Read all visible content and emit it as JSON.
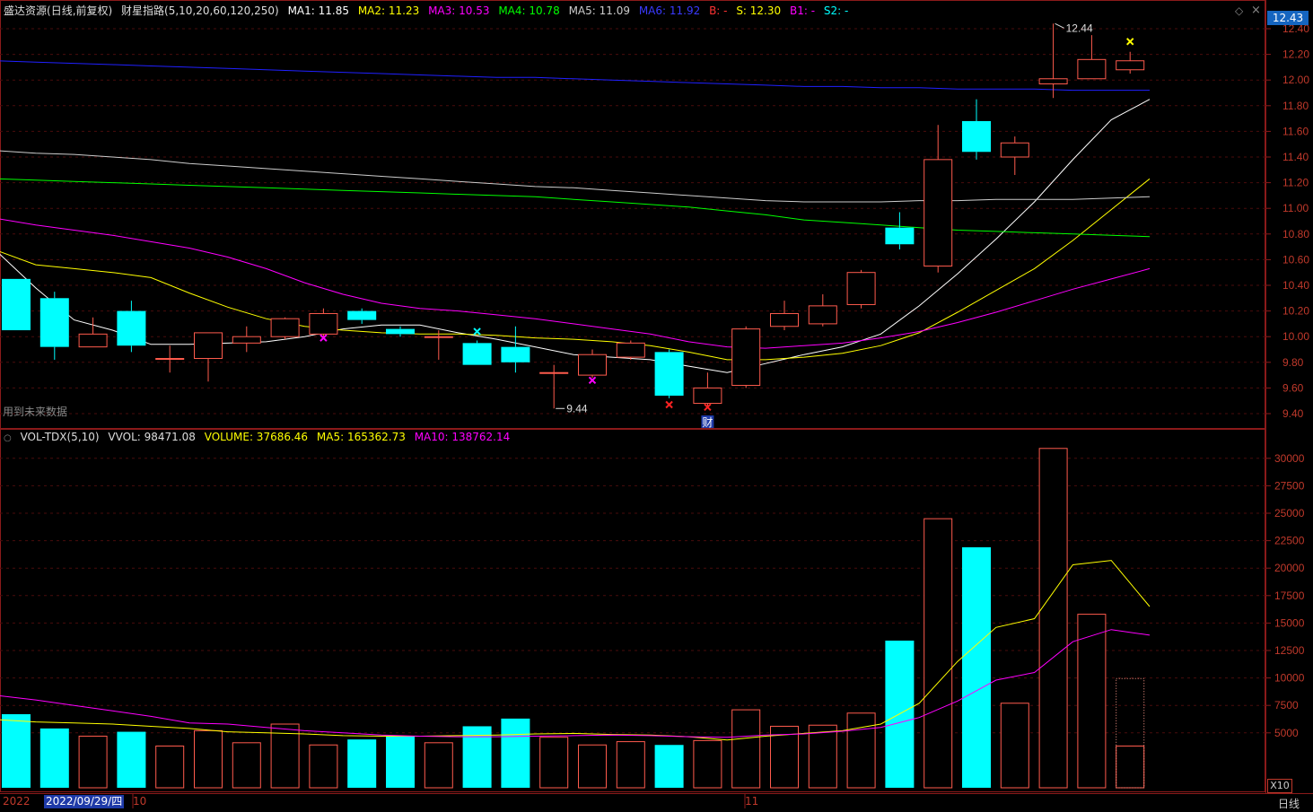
{
  "header": {
    "stock_name": "盛达资源",
    "period_mode": "(日线,前复权)",
    "indicator_name": "财星指路(5,10,20,60,120,250)",
    "ma1": "MA1: 11.85",
    "ma2": "MA2: 11.23",
    "ma3": "MA3: 10.53",
    "ma4": "MA4: 10.78",
    "ma5": "MA5: 11.09",
    "ma6": "MA6: 11.92",
    "b": "B: -",
    "s": "S: 12.30",
    "b1": "B1: -",
    "s2": "S2: -"
  },
  "vol_header": {
    "name": "VOL-TDX(5,10)",
    "vvol": "VVOL: 98471.08",
    "volume": "VOLUME: 37686.46",
    "ma5": "MA5: 165362.73",
    "ma10": "MA10: 138762.14"
  },
  "current_price_tag": "12.43",
  "future_data_note": "用到未来数据",
  "cai_marker": "财",
  "scale_label": "X10",
  "period_label": "日线",
  "date_labels": [
    "2022",
    "2022/09/29/四",
    "10",
    "11"
  ],
  "colors": {
    "up": "#ff5b4d",
    "down": "#00ffff",
    "ma1": "#ffffff",
    "ma2": "#ffff00",
    "ma3": "#ff00ff",
    "ma4": "#00ff00",
    "ma5": "#cccccc",
    "ma6": "#2020ff"
  },
  "chart_data": [
    {
      "type": "candlestick",
      "title": "",
      "ylim": [
        9.3,
        12.5
      ],
      "y_ticks": [
        9.4,
        9.6,
        9.8,
        10.0,
        10.2,
        10.4,
        10.6,
        10.8,
        11.0,
        11.2,
        11.4,
        11.6,
        11.8,
        12.0,
        12.2,
        12.4
      ],
      "annotations": [
        {
          "text": "12.44",
          "type": "high"
        },
        {
          "text": "9.44",
          "type": "low"
        }
      ],
      "candles": [
        {
          "open": 10.45,
          "close": 10.05,
          "high": 10.45,
          "low": 10.05
        },
        {
          "open": 10.3,
          "close": 9.92,
          "high": 10.35,
          "low": 9.82
        },
        {
          "open": 9.92,
          "close": 10.02,
          "high": 10.15,
          "low": 9.92
        },
        {
          "open": 10.2,
          "close": 9.93,
          "high": 10.28,
          "low": 9.88
        },
        {
          "open": 9.83,
          "close": 9.83,
          "high": 9.93,
          "low": 9.72
        },
        {
          "open": 9.83,
          "close": 10.03,
          "high": 10.03,
          "low": 9.65
        },
        {
          "open": 9.95,
          "close": 10.0,
          "high": 10.08,
          "low": 9.88
        },
        {
          "open": 10.0,
          "close": 10.14,
          "high": 10.15,
          "low": 9.98
        },
        {
          "open": 10.02,
          "close": 10.18,
          "high": 10.22,
          "low": 10.0
        },
        {
          "open": 10.2,
          "close": 10.13,
          "high": 10.22,
          "low": 10.1
        },
        {
          "open": 10.06,
          "close": 10.02,
          "high": 10.08,
          "low": 10.0
        },
        {
          "open": 10.0,
          "close": 10.0,
          "high": 10.05,
          "low": 9.82
        },
        {
          "open": 9.95,
          "close": 9.78,
          "high": 9.97,
          "low": 9.78
        },
        {
          "open": 9.92,
          "close": 9.8,
          "high": 10.08,
          "low": 9.72
        },
        {
          "open": 9.72,
          "close": 9.72,
          "high": 9.78,
          "low": 9.44
        },
        {
          "open": 9.7,
          "close": 9.86,
          "high": 9.9,
          "low": 9.68
        },
        {
          "open": 9.84,
          "close": 9.95,
          "high": 9.97,
          "low": 9.82
        },
        {
          "open": 9.88,
          "close": 9.54,
          "high": 9.9,
          "low": 9.52
        },
        {
          "open": 9.48,
          "close": 9.6,
          "high": 9.72,
          "low": 9.46
        },
        {
          "open": 9.62,
          "close": 10.06,
          "high": 10.08,
          "low": 9.6
        },
        {
          "open": 10.08,
          "close": 10.18,
          "high": 10.28,
          "low": 10.05
        },
        {
          "open": 10.1,
          "close": 10.24,
          "high": 10.33,
          "low": 10.08
        },
        {
          "open": 10.25,
          "close": 10.5,
          "high": 10.52,
          "low": 10.22
        },
        {
          "open": 10.85,
          "close": 10.72,
          "high": 10.97,
          "low": 10.68
        },
        {
          "open": 10.55,
          "close": 11.38,
          "high": 11.65,
          "low": 10.5
        },
        {
          "open": 11.68,
          "close": 11.44,
          "high": 11.85,
          "low": 11.38
        },
        {
          "open": 11.4,
          "close": 11.51,
          "high": 11.56,
          "low": 11.26
        },
        {
          "open": 11.97,
          "close": 12.01,
          "high": 12.44,
          "low": 11.86
        },
        {
          "open": 12.01,
          "close": 12.16,
          "high": 12.35,
          "low": 12.01
        },
        {
          "open": 12.08,
          "close": 12.15,
          "high": 12.22,
          "low": 12.05
        }
      ],
      "series": [
        {
          "name": "MA1",
          "values": [
            10.66,
            10.38,
            10.13,
            10.05,
            9.94,
            9.94,
            9.95,
            9.96,
            10.0,
            10.06,
            10.09,
            10.09,
            10.03,
            9.98,
            9.92,
            9.86,
            9.84,
            9.82,
            9.77,
            9.72,
            9.79,
            9.86,
            9.92,
            10.02,
            10.24,
            10.49,
            10.76,
            11.05,
            11.38,
            11.69,
            11.85
          ]
        },
        {
          "name": "MA2",
          "values": [
            10.67,
            10.56,
            10.53,
            10.5,
            10.46,
            10.34,
            10.23,
            10.14,
            10.08,
            10.05,
            10.03,
            10.02,
            10.02,
            10.01,
            9.99,
            9.98,
            9.96,
            9.93,
            9.88,
            9.82,
            9.82,
            9.84,
            9.87,
            9.93,
            10.03,
            10.19,
            10.36,
            10.53,
            10.75,
            10.99,
            11.23
          ]
        },
        {
          "name": "MA3",
          "values": [
            10.92,
            10.87,
            10.83,
            10.79,
            10.74,
            10.69,
            10.62,
            10.53,
            10.42,
            10.33,
            10.26,
            10.22,
            10.2,
            10.17,
            10.14,
            10.1,
            10.06,
            10.02,
            9.96,
            9.92,
            9.91,
            9.93,
            9.95,
            9.99,
            10.04,
            10.11,
            10.19,
            10.28,
            10.37,
            10.45,
            10.53
          ]
        },
        {
          "name": "MA4",
          "values": [
            11.23,
            11.22,
            11.21,
            11.2,
            11.19,
            11.18,
            11.17,
            11.16,
            11.15,
            11.14,
            11.13,
            11.12,
            11.11,
            11.1,
            11.09,
            11.07,
            11.05,
            11.03,
            11.01,
            10.98,
            10.95,
            10.91,
            10.89,
            10.87,
            10.85,
            10.83,
            10.82,
            10.81,
            10.8,
            10.79,
            10.78
          ]
        },
        {
          "name": "MA5",
          "values": [
            11.45,
            11.43,
            11.42,
            11.4,
            11.38,
            11.35,
            11.33,
            11.31,
            11.29,
            11.27,
            11.25,
            11.23,
            11.21,
            11.19,
            11.17,
            11.16,
            11.14,
            11.12,
            11.1,
            11.08,
            11.06,
            11.05,
            11.05,
            11.05,
            11.06,
            11.06,
            11.07,
            11.07,
            11.07,
            11.08,
            11.09
          ]
        },
        {
          "name": "MA6",
          "values": [
            12.15,
            12.14,
            12.13,
            12.12,
            12.11,
            12.1,
            12.09,
            12.08,
            12.07,
            12.06,
            12.05,
            12.04,
            12.03,
            12.02,
            12.02,
            12.01,
            12.0,
            11.99,
            11.98,
            11.97,
            11.96,
            11.95,
            11.95,
            11.94,
            11.94,
            11.93,
            11.93,
            11.93,
            11.92,
            11.92,
            11.92
          ]
        }
      ],
      "signals": [
        {
          "index": 8,
          "type": "x",
          "color": "#ff00ff",
          "value": 9.99
        },
        {
          "index": 12,
          "type": "x",
          "color": "#00ffff",
          "value": 10.04
        },
        {
          "index": 15,
          "type": "x",
          "color": "#ff00ff",
          "value": 9.66
        },
        {
          "index": 17,
          "type": "x",
          "color": "#ff2222",
          "value": 9.47
        },
        {
          "index": 18,
          "type": "x",
          "color": "#ff2222",
          "value": 9.45
        },
        {
          "index": 29,
          "type": "x",
          "color": "#ffff00",
          "value": 12.3
        }
      ]
    },
    {
      "type": "bar",
      "title": "",
      "ylim": [
        0,
        32000
      ],
      "y_ticks": [
        5000,
        7500,
        10000,
        12500,
        15000,
        17500,
        20000,
        22500,
        25000,
        27500,
        30000
      ],
      "volumes": [
        6700,
        5400,
        4700,
        5100,
        3800,
        5200,
        4100,
        5800,
        3900,
        4400,
        4700,
        4100,
        5600,
        6300,
        4600,
        3900,
        4200,
        3900,
        4300,
        7100,
        5600,
        5700,
        6800,
        13400,
        24500,
        21900,
        7700,
        30900,
        15800,
        3800
      ],
      "estimate_last": 9950,
      "series": [
        {
          "name": "MA5",
          "values": [
            6200,
            6000,
            5900,
            5800,
            5600,
            5400,
            5100,
            5000,
            4900,
            4750,
            4700,
            4700,
            4750,
            4800,
            4900,
            4950,
            4850,
            4800,
            4650,
            4350,
            4700,
            4950,
            5200,
            5800,
            7700,
            11500,
            14600,
            15400,
            20300,
            20700,
            16500
          ]
        },
        {
          "name": "MA10",
          "values": [
            8400,
            8000,
            7500,
            7000,
            6500,
            5900,
            5800,
            5500,
            5200,
            5000,
            4800,
            4700,
            4650,
            4650,
            4700,
            4750,
            4800,
            4750,
            4650,
            4600,
            4800,
            4900,
            5150,
            5500,
            6400,
            7900,
            9800,
            10500,
            13300,
            14400,
            13900
          ]
        }
      ]
    }
  ]
}
